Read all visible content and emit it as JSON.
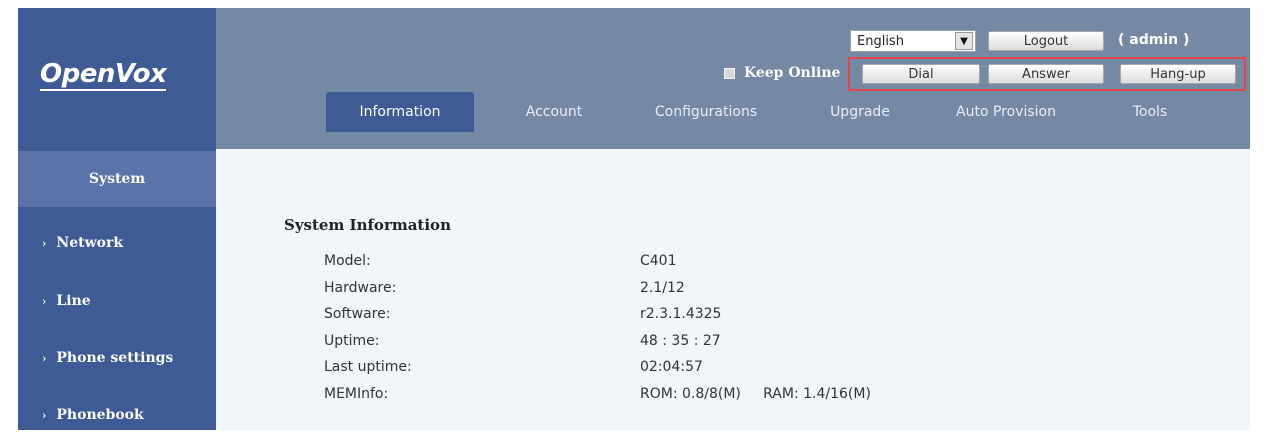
{
  "brand": {
    "logo_text": "OpenVox"
  },
  "header": {
    "language": {
      "selected": "English"
    },
    "logout_label": "Logout",
    "admin_label": "( admin )",
    "keep_online_label": "Keep Online",
    "keep_online_checked": true,
    "call_buttons": {
      "dial": "Dial",
      "answer": "Answer",
      "hangup": "Hang-up"
    },
    "highlight_color": "#e0474d"
  },
  "nav": {
    "tabs": [
      {
        "label": "Information",
        "active": true
      },
      {
        "label": "Account"
      },
      {
        "label": "Configurations"
      },
      {
        "label": "Upgrade"
      },
      {
        "label": "Auto Provision"
      },
      {
        "label": "Tools"
      }
    ]
  },
  "sidebar": {
    "items": [
      {
        "label": "System",
        "active": true
      },
      {
        "label": "Network"
      },
      {
        "label": "Line"
      },
      {
        "label": "Phone settings"
      },
      {
        "label": "Phonebook"
      }
    ]
  },
  "main": {
    "section_title": "System Information",
    "rows": [
      {
        "label": "Model:",
        "value": "C401"
      },
      {
        "label": "Hardware:",
        "value": "2.1/12"
      },
      {
        "label": "Software:",
        "value": "r2.3.1.4325"
      },
      {
        "label": "Uptime:",
        "value": "48 : 35 : 27"
      },
      {
        "label": "Last uptime:",
        "value": "02:04:57"
      },
      {
        "label": "MEMInfo:",
        "value": "ROM: 0.8/8(M)     RAM: 1.4/16(M)"
      }
    ]
  },
  "colors": {
    "sidebar": "#3f5b96",
    "header": "#7689a4",
    "content": "#f0f6f9"
  }
}
